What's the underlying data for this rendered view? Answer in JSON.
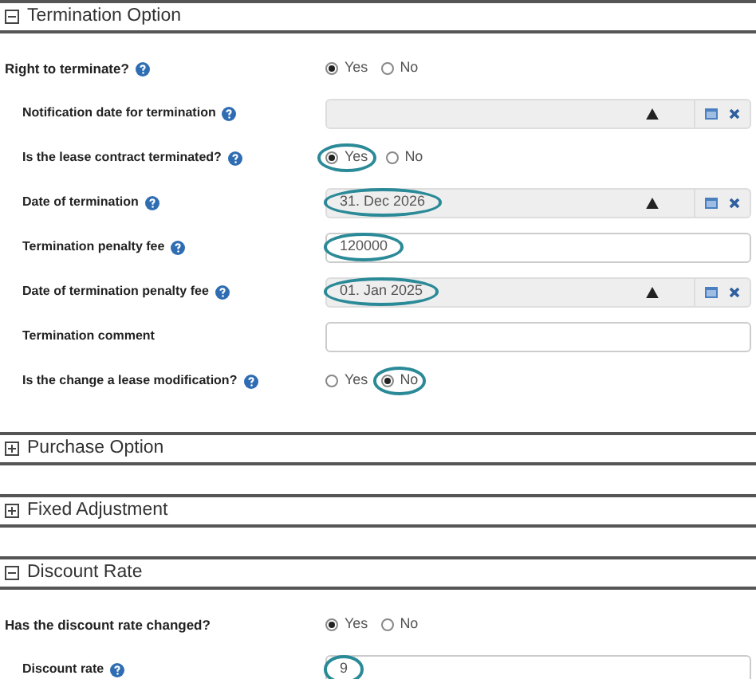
{
  "sections": [
    {
      "title": "Termination Option",
      "expanded": true,
      "rows": [
        {
          "kind": "radio",
          "label": "Right to terminate?",
          "help": true,
          "nested": false,
          "options": [
            {
              "label": "Yes",
              "selected": true,
              "highlighted": false
            },
            {
              "label": "No",
              "selected": false,
              "highlighted": false
            }
          ]
        },
        {
          "kind": "date",
          "label": "Notification date for termination",
          "help": true,
          "nested": true
        },
        {
          "kind": "radio",
          "label": "Is the lease contract terminated?",
          "help": true,
          "nested": true,
          "options": [
            {
              "label": "Yes",
              "selected": true,
              "highlighted": true
            },
            {
              "label": "No",
              "selected": false,
              "highlighted": false
            }
          ]
        },
        {
          "kind": "date",
          "label": "Date of termination",
          "help": true,
          "nested": true,
          "value": "31. Dec 2026",
          "highlighted": true
        },
        {
          "kind": "text",
          "label": "Termination penalty fee",
          "help": true,
          "nested": true,
          "value": "120000",
          "highlighted": true
        },
        {
          "kind": "date",
          "label": "Date of termination penalty fee",
          "help": true,
          "nested": true,
          "value": "01. Jan 2025",
          "highlighted": true
        },
        {
          "kind": "text",
          "label": "Termination comment",
          "help": false,
          "nested": true
        },
        {
          "kind": "radio",
          "label": "Is the change a lease modification?",
          "help": true,
          "nested": true,
          "options": [
            {
              "label": "Yes",
              "selected": false,
              "highlighted": false
            },
            {
              "label": "No",
              "selected": true,
              "highlighted": true
            }
          ]
        }
      ]
    },
    {
      "title": "Purchase Option",
      "expanded": false
    },
    {
      "title": "Fixed Adjustment",
      "expanded": false
    },
    {
      "title": "Discount Rate",
      "expanded": true,
      "rows": [
        {
          "kind": "radio",
          "label": "Has the discount rate changed?",
          "help": false,
          "nested": false,
          "options": [
            {
              "label": "Yes",
              "selected": true,
              "highlighted": false
            },
            {
              "label": "No",
              "selected": false,
              "highlighted": false
            }
          ]
        },
        {
          "kind": "text",
          "label": "Discount rate",
          "help": true,
          "nested": true,
          "value": "9",
          "highlighted": true
        }
      ]
    }
  ]
}
